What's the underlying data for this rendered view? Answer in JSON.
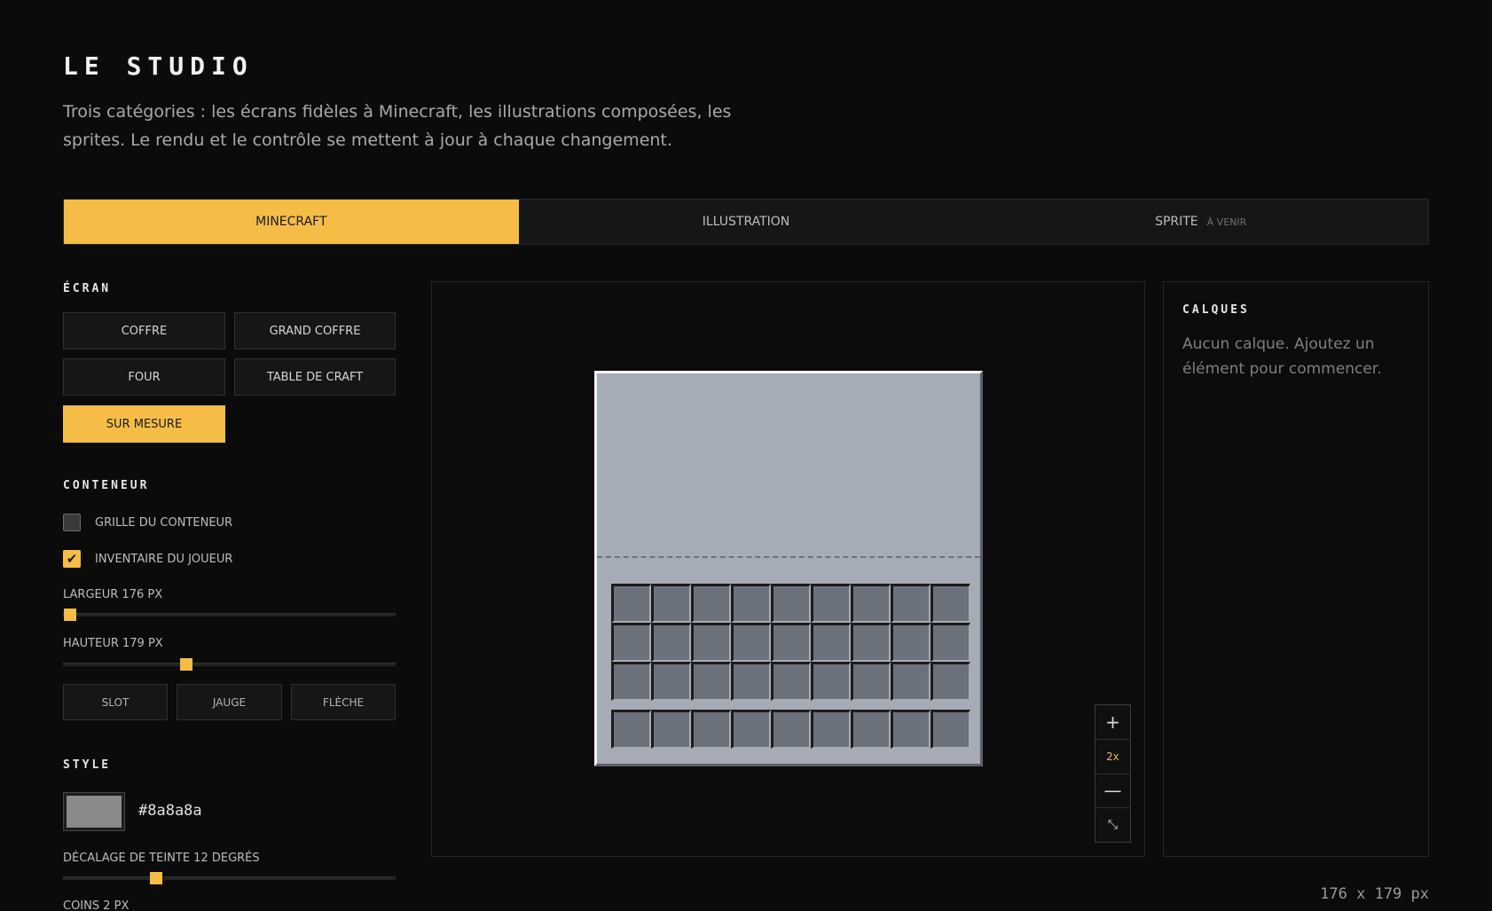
{
  "header": {
    "title": "LE STUDIO",
    "subtitle": "Trois catégories : les écrans fidèles à Minecraft, les illustrations composées, les sprites. Le rendu et le contrôle se mettent à jour à chaque changement."
  },
  "tabs": [
    {
      "label": "MINECRAFT",
      "active": true
    },
    {
      "label": "ILLUSTRATION",
      "active": false
    },
    {
      "label": "SPRITE",
      "badge": "À VENIR",
      "active": false
    }
  ],
  "ecran": {
    "label": "ÉCRAN",
    "buttons": [
      "COFFRE",
      "GRAND COFFRE",
      "FOUR",
      "TABLE DE CRAFT",
      "SUR MESURE"
    ],
    "selected": "SUR MESURE"
  },
  "conteneur": {
    "label": "CONTENEUR",
    "grid_label": "GRILLE DU CONTENEUR",
    "grid_checked": false,
    "inventory_label": "INVENTAIRE DU JOUEUR",
    "inventory_checked": true,
    "width_label": "LARGEUR 176 PX",
    "width_value_fraction": 0.02,
    "height_label": "HAUTEUR 179 PX",
    "height_value_fraction": 0.37,
    "add_buttons": [
      "SLOT",
      "JAUGE",
      "FLÈCHE"
    ]
  },
  "style": {
    "label": "STYLE",
    "color": "#8a8a8a",
    "hue_label": "DÉCALAGE DE TEINTE 12 DEGRÉS",
    "hue_value_fraction": 0.28,
    "corners_label": "COINS 2 PX"
  },
  "canvas": {
    "gui_background": "#a6acb5",
    "slot_color": "#6c727b",
    "inventory_rows": 3,
    "hotbar_rows": 1,
    "columns": 9
  },
  "zoom": {
    "plus": "+",
    "level": "2x",
    "minus": "—",
    "fit": "⤡"
  },
  "layers": {
    "title": "CALQUES",
    "empty": "Aucun calque. Ajoutez un élément pour commencer."
  },
  "dimensions": "176 x 179 px",
  "colors": {
    "accent": "#f5bd45",
    "background": "#0b0b0b"
  }
}
